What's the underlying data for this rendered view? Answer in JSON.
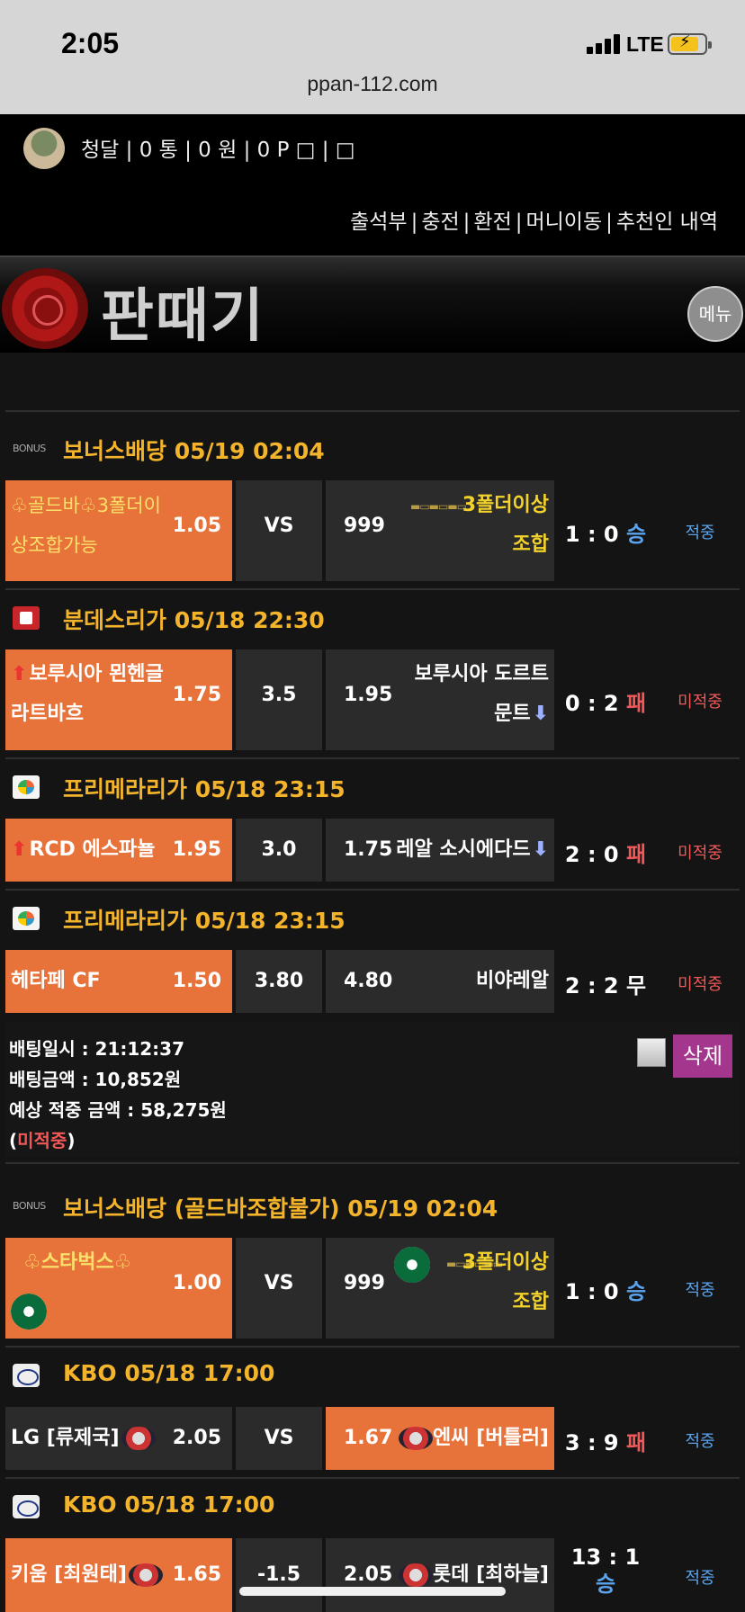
{
  "status_bar": {
    "time": "2:05",
    "network": "LTE",
    "url": "ppan-112.com"
  },
  "user_bar": {
    "info": "청달 | 0 통 | 0 원 | 0 P □ | □",
    "menu": [
      "출석부",
      "충전",
      "환전",
      "머니이동",
      "추천인 내역"
    ]
  },
  "header": {
    "logo_text": "판때기",
    "menu_button": "메뉴"
  },
  "sections": [
    {
      "title": "보너스배당 05/19 02:04",
      "icon": "bonus-icon",
      "icon_text": "BONUS",
      "bet": {
        "home": {
          "name": "♧골드바♧3폴더이상조합가능",
          "odds": "1.05"
        },
        "draw": "VS",
        "away": {
          "name": "3폴더이상조합",
          "odds": "999"
        },
        "score": "1 : 0",
        "result": "승",
        "status": "적중"
      }
    },
    {
      "title": "분데스리가 05/18 22:30",
      "icon": "bundesliga-icon",
      "bet": {
        "home": {
          "name": "보루시아 묀헨글라트바흐",
          "odds": "1.75"
        },
        "draw": "3.5",
        "away": {
          "name": "보루시아 도르트문트",
          "odds": "1.95"
        },
        "score": "0 : 2",
        "result": "패",
        "status": "미적중"
      }
    },
    {
      "title": "프리메라리가 05/18 23:15",
      "icon": "laliga-icon",
      "bet": {
        "home": {
          "name": "RCD 에스파뇰",
          "odds": "1.95"
        },
        "draw": "3.0",
        "away": {
          "name": "레알 소시에다드",
          "odds": "1.75"
        },
        "score": "2 : 0",
        "result": "패",
        "status": "미적중"
      }
    },
    {
      "title": "프리메라리가 05/18 23:15",
      "icon": "laliga-icon",
      "bet": {
        "home": {
          "name": "헤타페 CF",
          "odds": "1.50"
        },
        "draw": "3.80",
        "away": {
          "name": "비야레알",
          "odds": "4.80"
        },
        "score": "2 : 2",
        "result": "무",
        "status": "미적중"
      }
    },
    {
      "title": "보너스배당 (골드바조합불가) 05/19 02:04",
      "icon": "bonus-icon",
      "icon_text": "BONUS",
      "bet": {
        "home": {
          "name": "♧스타벅스♧",
          "odds": "1.00"
        },
        "draw": "VS",
        "away": {
          "name": "3폴더이상조합",
          "odds": "999"
        },
        "score": "1 : 0",
        "result": "승",
        "status": "적중"
      }
    },
    {
      "title": "KBO 05/18 17:00",
      "icon": "kbo-icon",
      "bet": {
        "home": {
          "name": "LG [류제국]",
          "odds": "2.05"
        },
        "draw": "VS",
        "away": {
          "name": "엔씨 [버틀러]",
          "odds": "1.67"
        },
        "score": "3 : 9",
        "result": "패",
        "status": "적중"
      }
    },
    {
      "title": "KBO 05/18 17:00",
      "icon": "kbo-icon",
      "bet": {
        "home": {
          "name": "키움 [최원태]",
          "odds": "1.65"
        },
        "draw": "-1.5",
        "away": {
          "name": "롯데 [최하늘]",
          "odds": "2.05"
        },
        "score": "13 : 1",
        "result": "승",
        "status": "적중"
      }
    }
  ],
  "bet_info": {
    "time_label": "배팅일시 : 21:12:37",
    "amount_label": "배팅금액 : 10,852원",
    "expected_label": "예상 적중 금액 : 58,275원",
    "status_open": "(",
    "status_text": "미적중",
    "status_close": ")",
    "delete_button": "삭제"
  }
}
